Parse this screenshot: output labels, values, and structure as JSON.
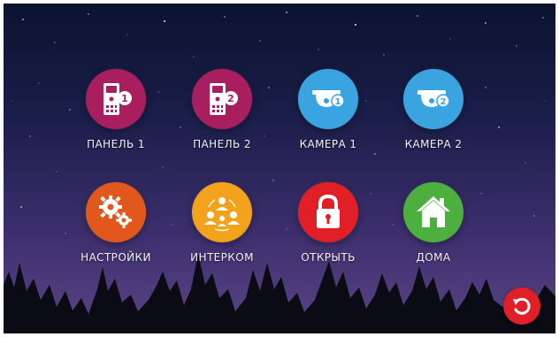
{
  "tiles": [
    {
      "label": "ПАНЕЛЬ 1",
      "icon": "door-panel-1-icon",
      "color": "#a81e5e"
    },
    {
      "label": "ПАНЕЛЬ 2",
      "icon": "door-panel-2-icon",
      "color": "#a81e5e"
    },
    {
      "label": "КАМЕРА 1",
      "icon": "dome-camera-1-icon",
      "color": "#3aa4e0"
    },
    {
      "label": "КАМЕРА 2",
      "icon": "dome-camera-2-icon",
      "color": "#3aa4e0"
    },
    {
      "label": "НАСТРОЙКИ",
      "icon": "gears-icon",
      "color": "#e2571c"
    },
    {
      "label": "ИНТЕРКОМ",
      "icon": "intercom-people-icon",
      "color": "#f3a21b"
    },
    {
      "label": "ОТКРЫТЬ",
      "icon": "padlock-icon",
      "color": "#e11f26"
    },
    {
      "label": "ДОМА",
      "icon": "home-icon",
      "color": "#4caf3e"
    }
  ],
  "badges": {
    "panel1": "1",
    "panel2": "2",
    "camera1": "1",
    "camera2": "2"
  },
  "back_button": {
    "icon": "back-arrow-icon",
    "color": "#e11f26"
  }
}
